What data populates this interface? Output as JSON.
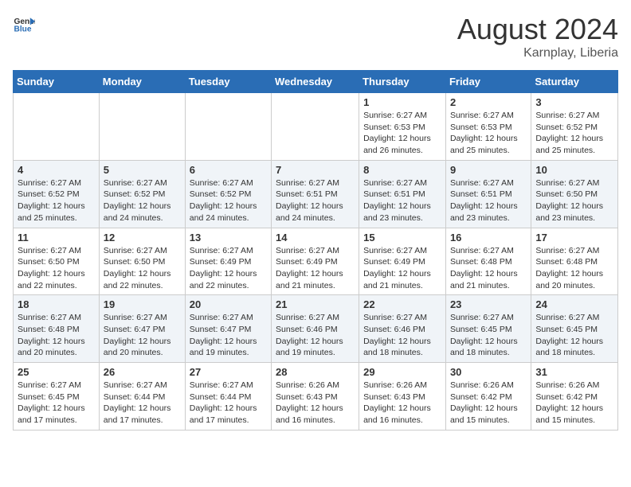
{
  "header": {
    "logo_general": "General",
    "logo_blue": "Blue",
    "month_year": "August 2024",
    "location": "Karnplay, Liberia"
  },
  "weekdays": [
    "Sunday",
    "Monday",
    "Tuesday",
    "Wednesday",
    "Thursday",
    "Friday",
    "Saturday"
  ],
  "weeks": [
    [
      {
        "day": "",
        "info": ""
      },
      {
        "day": "",
        "info": ""
      },
      {
        "day": "",
        "info": ""
      },
      {
        "day": "",
        "info": ""
      },
      {
        "day": "1",
        "info": "Sunrise: 6:27 AM\nSunset: 6:53 PM\nDaylight: 12 hours\nand 26 minutes."
      },
      {
        "day": "2",
        "info": "Sunrise: 6:27 AM\nSunset: 6:53 PM\nDaylight: 12 hours\nand 25 minutes."
      },
      {
        "day": "3",
        "info": "Sunrise: 6:27 AM\nSunset: 6:52 PM\nDaylight: 12 hours\nand 25 minutes."
      }
    ],
    [
      {
        "day": "4",
        "info": "Sunrise: 6:27 AM\nSunset: 6:52 PM\nDaylight: 12 hours\nand 25 minutes."
      },
      {
        "day": "5",
        "info": "Sunrise: 6:27 AM\nSunset: 6:52 PM\nDaylight: 12 hours\nand 24 minutes."
      },
      {
        "day": "6",
        "info": "Sunrise: 6:27 AM\nSunset: 6:52 PM\nDaylight: 12 hours\nand 24 minutes."
      },
      {
        "day": "7",
        "info": "Sunrise: 6:27 AM\nSunset: 6:51 PM\nDaylight: 12 hours\nand 24 minutes."
      },
      {
        "day": "8",
        "info": "Sunrise: 6:27 AM\nSunset: 6:51 PM\nDaylight: 12 hours\nand 23 minutes."
      },
      {
        "day": "9",
        "info": "Sunrise: 6:27 AM\nSunset: 6:51 PM\nDaylight: 12 hours\nand 23 minutes."
      },
      {
        "day": "10",
        "info": "Sunrise: 6:27 AM\nSunset: 6:50 PM\nDaylight: 12 hours\nand 23 minutes."
      }
    ],
    [
      {
        "day": "11",
        "info": "Sunrise: 6:27 AM\nSunset: 6:50 PM\nDaylight: 12 hours\nand 22 minutes."
      },
      {
        "day": "12",
        "info": "Sunrise: 6:27 AM\nSunset: 6:50 PM\nDaylight: 12 hours\nand 22 minutes."
      },
      {
        "day": "13",
        "info": "Sunrise: 6:27 AM\nSunset: 6:49 PM\nDaylight: 12 hours\nand 22 minutes."
      },
      {
        "day": "14",
        "info": "Sunrise: 6:27 AM\nSunset: 6:49 PM\nDaylight: 12 hours\nand 21 minutes."
      },
      {
        "day": "15",
        "info": "Sunrise: 6:27 AM\nSunset: 6:49 PM\nDaylight: 12 hours\nand 21 minutes."
      },
      {
        "day": "16",
        "info": "Sunrise: 6:27 AM\nSunset: 6:48 PM\nDaylight: 12 hours\nand 21 minutes."
      },
      {
        "day": "17",
        "info": "Sunrise: 6:27 AM\nSunset: 6:48 PM\nDaylight: 12 hours\nand 20 minutes."
      }
    ],
    [
      {
        "day": "18",
        "info": "Sunrise: 6:27 AM\nSunset: 6:48 PM\nDaylight: 12 hours\nand 20 minutes."
      },
      {
        "day": "19",
        "info": "Sunrise: 6:27 AM\nSunset: 6:47 PM\nDaylight: 12 hours\nand 20 minutes."
      },
      {
        "day": "20",
        "info": "Sunrise: 6:27 AM\nSunset: 6:47 PM\nDaylight: 12 hours\nand 19 minutes."
      },
      {
        "day": "21",
        "info": "Sunrise: 6:27 AM\nSunset: 6:46 PM\nDaylight: 12 hours\nand 19 minutes."
      },
      {
        "day": "22",
        "info": "Sunrise: 6:27 AM\nSunset: 6:46 PM\nDaylight: 12 hours\nand 18 minutes."
      },
      {
        "day": "23",
        "info": "Sunrise: 6:27 AM\nSunset: 6:45 PM\nDaylight: 12 hours\nand 18 minutes."
      },
      {
        "day": "24",
        "info": "Sunrise: 6:27 AM\nSunset: 6:45 PM\nDaylight: 12 hours\nand 18 minutes."
      }
    ],
    [
      {
        "day": "25",
        "info": "Sunrise: 6:27 AM\nSunset: 6:45 PM\nDaylight: 12 hours\nand 17 minutes."
      },
      {
        "day": "26",
        "info": "Sunrise: 6:27 AM\nSunset: 6:44 PM\nDaylight: 12 hours\nand 17 minutes."
      },
      {
        "day": "27",
        "info": "Sunrise: 6:27 AM\nSunset: 6:44 PM\nDaylight: 12 hours\nand 17 minutes."
      },
      {
        "day": "28",
        "info": "Sunrise: 6:26 AM\nSunset: 6:43 PM\nDaylight: 12 hours\nand 16 minutes."
      },
      {
        "day": "29",
        "info": "Sunrise: 6:26 AM\nSunset: 6:43 PM\nDaylight: 12 hours\nand 16 minutes."
      },
      {
        "day": "30",
        "info": "Sunrise: 6:26 AM\nSunset: 6:42 PM\nDaylight: 12 hours\nand 15 minutes."
      },
      {
        "day": "31",
        "info": "Sunrise: 6:26 AM\nSunset: 6:42 PM\nDaylight: 12 hours\nand 15 minutes."
      }
    ]
  ]
}
